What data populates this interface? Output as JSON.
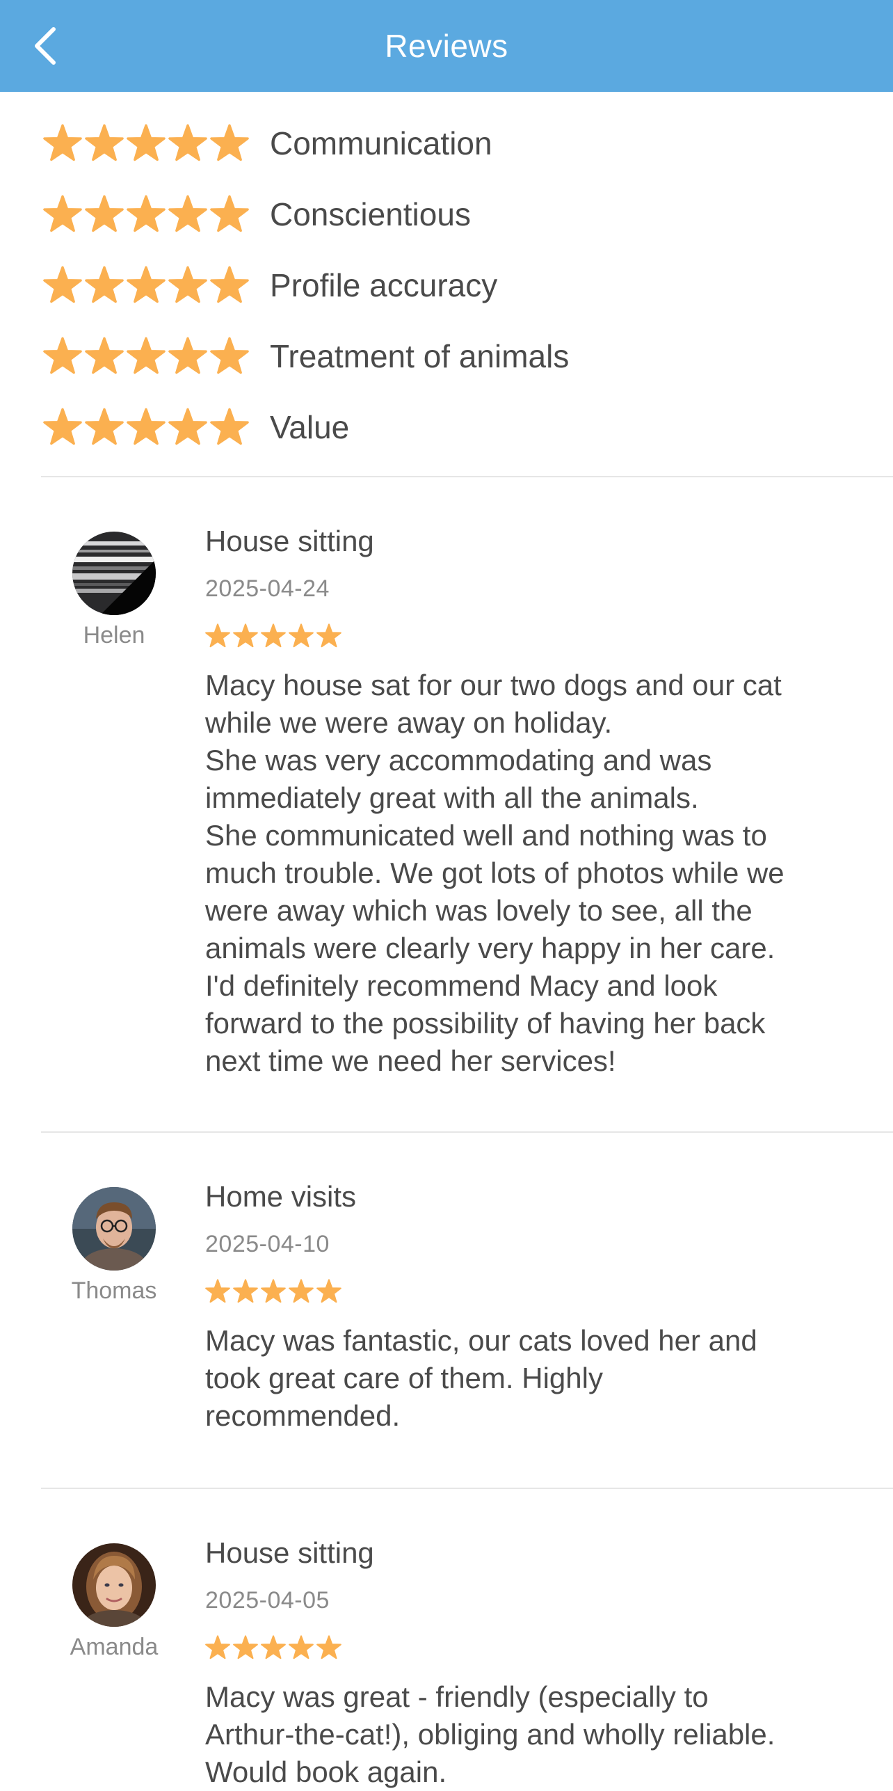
{
  "header": {
    "title": "Reviews",
    "back_icon": "chevron-left-icon"
  },
  "colors": {
    "header_bg": "#5ba9e0",
    "star": "#fbb050",
    "text": "#4a4a4a",
    "muted": "#8a8a8a"
  },
  "ratings": [
    {
      "label": "Communication",
      "stars": 5
    },
    {
      "label": "Conscientious",
      "stars": 5
    },
    {
      "label": "Profile accuracy",
      "stars": 5
    },
    {
      "label": "Treatment of animals",
      "stars": 5
    },
    {
      "label": "Value",
      "stars": 5
    }
  ],
  "reviews": [
    {
      "name": "Helen",
      "service": "House sitting",
      "date": "2025-04-24",
      "stars": 5,
      "text": "Macy house sat for our two dogs and our cat\nwhile we were away on holiday.\nShe was very accommodating and was\nimmediately great with all the animals.\nShe communicated well and nothing was to\nmuch trouble. We got lots of photos while we\nwere away which was lovely to see, all the\nanimals were clearly very happy in her care.\nI'd definitely recommend Macy and look\nforward to the possibility of having her back\nnext time we need her services!"
    },
    {
      "name": "Thomas",
      "service": "Home visits",
      "date": "2025-04-10",
      "stars": 5,
      "text": "Macy was fantastic, our cats loved her and\ntook great care of them. Highly\nrecommended."
    },
    {
      "name": "Amanda",
      "service": "House sitting",
      "date": "2025-04-05",
      "stars": 5,
      "text": "Macy was great - friendly (especially to\nArthur-the-cat!), obliging and wholly reliable.\nWould book again."
    }
  ]
}
